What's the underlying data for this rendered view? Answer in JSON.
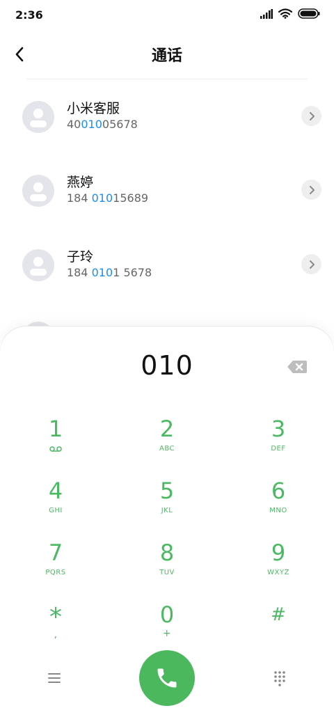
{
  "status_bar": {
    "time": "2:36"
  },
  "header": {
    "title": "通话"
  },
  "contacts": [
    {
      "name": "小米客服",
      "number_prefix": "40",
      "number_match": "010",
      "number_suffix": "05678"
    },
    {
      "name": "燕婷",
      "number_prefix": "184 ",
      "number_match": "010",
      "number_suffix": "15689"
    },
    {
      "name": "子玲",
      "number_prefix": "184 ",
      "number_match": "010",
      "number_suffix": "1 5678"
    }
  ],
  "dialer": {
    "entered_number": "010",
    "keys": [
      {
        "digit": "1",
        "letters": ""
      },
      {
        "digit": "2",
        "letters": "ABC"
      },
      {
        "digit": "3",
        "letters": "DEF"
      },
      {
        "digit": "4",
        "letters": "GHI"
      },
      {
        "digit": "5",
        "letters": "JKL"
      },
      {
        "digit": "6",
        "letters": "MNO"
      },
      {
        "digit": "7",
        "letters": "PQRS"
      },
      {
        "digit": "8",
        "letters": "TUV"
      },
      {
        "digit": "9",
        "letters": "WXYZ"
      },
      {
        "digit": "*",
        "letters": ","
      },
      {
        "digit": "0",
        "letters": "+"
      },
      {
        "digit": "#",
        "letters": ""
      }
    ]
  },
  "colors": {
    "accent_green": "#4bb862",
    "highlight_blue": "#1a8ef2",
    "call_button": "#4cb85e"
  },
  "icons": [
    "signal-icon",
    "wifi-icon",
    "battery-icon",
    "back-arrow-icon",
    "contact-avatar-icon",
    "chevron-right-icon",
    "backspace-icon",
    "voicemail-icon",
    "menu-icon",
    "phone-icon",
    "dialpad-icon"
  ]
}
